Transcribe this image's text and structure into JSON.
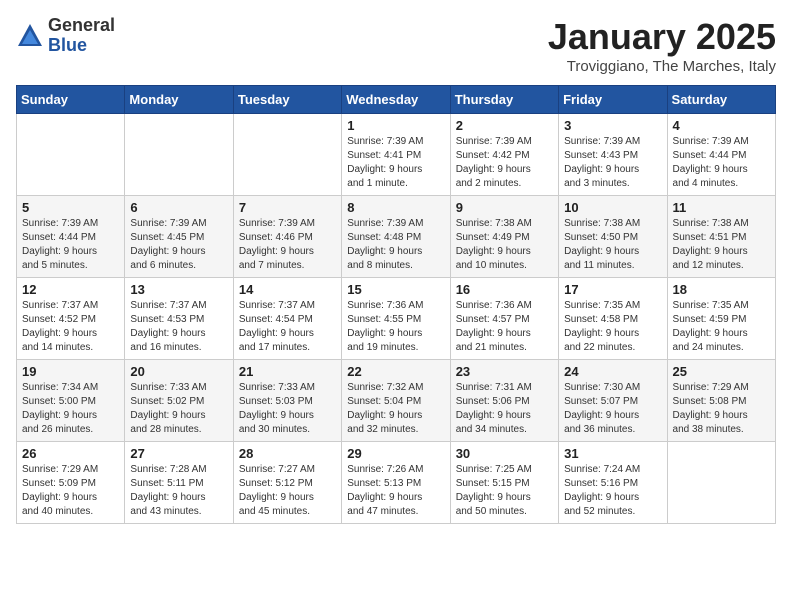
{
  "logo": {
    "general": "General",
    "blue": "Blue"
  },
  "header": {
    "month": "January 2025",
    "location": "Troviggiano, The Marches, Italy"
  },
  "weekdays": [
    "Sunday",
    "Monday",
    "Tuesday",
    "Wednesday",
    "Thursday",
    "Friday",
    "Saturday"
  ],
  "weeks": [
    [
      {
        "day": "",
        "info": ""
      },
      {
        "day": "",
        "info": ""
      },
      {
        "day": "",
        "info": ""
      },
      {
        "day": "1",
        "info": "Sunrise: 7:39 AM\nSunset: 4:41 PM\nDaylight: 9 hours\nand 1 minute."
      },
      {
        "day": "2",
        "info": "Sunrise: 7:39 AM\nSunset: 4:42 PM\nDaylight: 9 hours\nand 2 minutes."
      },
      {
        "day": "3",
        "info": "Sunrise: 7:39 AM\nSunset: 4:43 PM\nDaylight: 9 hours\nand 3 minutes."
      },
      {
        "day": "4",
        "info": "Sunrise: 7:39 AM\nSunset: 4:44 PM\nDaylight: 9 hours\nand 4 minutes."
      }
    ],
    [
      {
        "day": "5",
        "info": "Sunrise: 7:39 AM\nSunset: 4:44 PM\nDaylight: 9 hours\nand 5 minutes."
      },
      {
        "day": "6",
        "info": "Sunrise: 7:39 AM\nSunset: 4:45 PM\nDaylight: 9 hours\nand 6 minutes."
      },
      {
        "day": "7",
        "info": "Sunrise: 7:39 AM\nSunset: 4:46 PM\nDaylight: 9 hours\nand 7 minutes."
      },
      {
        "day": "8",
        "info": "Sunrise: 7:39 AM\nSunset: 4:48 PM\nDaylight: 9 hours\nand 8 minutes."
      },
      {
        "day": "9",
        "info": "Sunrise: 7:38 AM\nSunset: 4:49 PM\nDaylight: 9 hours\nand 10 minutes."
      },
      {
        "day": "10",
        "info": "Sunrise: 7:38 AM\nSunset: 4:50 PM\nDaylight: 9 hours\nand 11 minutes."
      },
      {
        "day": "11",
        "info": "Sunrise: 7:38 AM\nSunset: 4:51 PM\nDaylight: 9 hours\nand 12 minutes."
      }
    ],
    [
      {
        "day": "12",
        "info": "Sunrise: 7:37 AM\nSunset: 4:52 PM\nDaylight: 9 hours\nand 14 minutes."
      },
      {
        "day": "13",
        "info": "Sunrise: 7:37 AM\nSunset: 4:53 PM\nDaylight: 9 hours\nand 16 minutes."
      },
      {
        "day": "14",
        "info": "Sunrise: 7:37 AM\nSunset: 4:54 PM\nDaylight: 9 hours\nand 17 minutes."
      },
      {
        "day": "15",
        "info": "Sunrise: 7:36 AM\nSunset: 4:55 PM\nDaylight: 9 hours\nand 19 minutes."
      },
      {
        "day": "16",
        "info": "Sunrise: 7:36 AM\nSunset: 4:57 PM\nDaylight: 9 hours\nand 21 minutes."
      },
      {
        "day": "17",
        "info": "Sunrise: 7:35 AM\nSunset: 4:58 PM\nDaylight: 9 hours\nand 22 minutes."
      },
      {
        "day": "18",
        "info": "Sunrise: 7:35 AM\nSunset: 4:59 PM\nDaylight: 9 hours\nand 24 minutes."
      }
    ],
    [
      {
        "day": "19",
        "info": "Sunrise: 7:34 AM\nSunset: 5:00 PM\nDaylight: 9 hours\nand 26 minutes."
      },
      {
        "day": "20",
        "info": "Sunrise: 7:33 AM\nSunset: 5:02 PM\nDaylight: 9 hours\nand 28 minutes."
      },
      {
        "day": "21",
        "info": "Sunrise: 7:33 AM\nSunset: 5:03 PM\nDaylight: 9 hours\nand 30 minutes."
      },
      {
        "day": "22",
        "info": "Sunrise: 7:32 AM\nSunset: 5:04 PM\nDaylight: 9 hours\nand 32 minutes."
      },
      {
        "day": "23",
        "info": "Sunrise: 7:31 AM\nSunset: 5:06 PM\nDaylight: 9 hours\nand 34 minutes."
      },
      {
        "day": "24",
        "info": "Sunrise: 7:30 AM\nSunset: 5:07 PM\nDaylight: 9 hours\nand 36 minutes."
      },
      {
        "day": "25",
        "info": "Sunrise: 7:29 AM\nSunset: 5:08 PM\nDaylight: 9 hours\nand 38 minutes."
      }
    ],
    [
      {
        "day": "26",
        "info": "Sunrise: 7:29 AM\nSunset: 5:09 PM\nDaylight: 9 hours\nand 40 minutes."
      },
      {
        "day": "27",
        "info": "Sunrise: 7:28 AM\nSunset: 5:11 PM\nDaylight: 9 hours\nand 43 minutes."
      },
      {
        "day": "28",
        "info": "Sunrise: 7:27 AM\nSunset: 5:12 PM\nDaylight: 9 hours\nand 45 minutes."
      },
      {
        "day": "29",
        "info": "Sunrise: 7:26 AM\nSunset: 5:13 PM\nDaylight: 9 hours\nand 47 minutes."
      },
      {
        "day": "30",
        "info": "Sunrise: 7:25 AM\nSunset: 5:15 PM\nDaylight: 9 hours\nand 50 minutes."
      },
      {
        "day": "31",
        "info": "Sunrise: 7:24 AM\nSunset: 5:16 PM\nDaylight: 9 hours\nand 52 minutes."
      },
      {
        "day": "",
        "info": ""
      }
    ]
  ]
}
